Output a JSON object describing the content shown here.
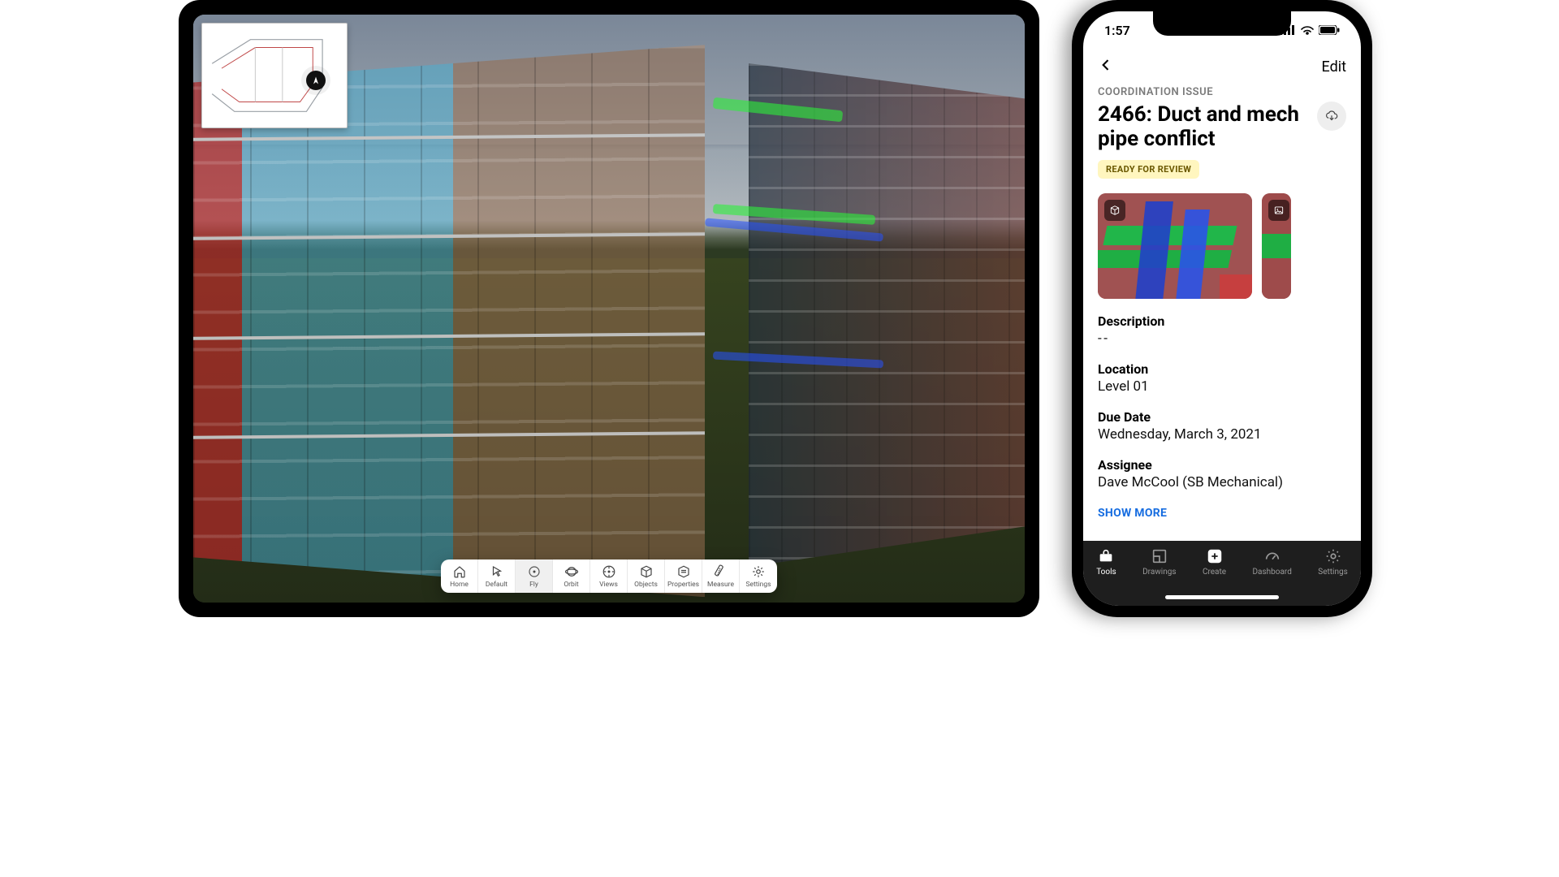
{
  "statusbar": {
    "time": "1:57"
  },
  "viewer": {
    "toolbar": [
      {
        "id": "home",
        "label": "Home"
      },
      {
        "id": "default",
        "label": "Default"
      },
      {
        "id": "fly",
        "label": "Fly",
        "active": true
      },
      {
        "id": "orbit",
        "label": "Orbit"
      },
      {
        "id": "views",
        "label": "Views"
      },
      {
        "id": "objects",
        "label": "Objects"
      },
      {
        "id": "properties",
        "label": "Properties"
      },
      {
        "id": "measure",
        "label": "Measure"
      },
      {
        "id": "settings",
        "label": "Settings"
      }
    ]
  },
  "issue": {
    "nav_edit": "Edit",
    "eyebrow": "COORDINATION ISSUE",
    "title": "2466: Duct and mech pipe conflict",
    "status_badge": "READY FOR REVIEW",
    "description_label": "Description",
    "description_value": "--",
    "location_label": "Location",
    "location_value": "Level 01",
    "due_label": "Due Date",
    "due_value": "Wednesday, March 3, 2021",
    "assignee_label": "Assignee",
    "assignee_value": "Dave McCool (SB Mechanical)",
    "show_more": "SHOW MORE"
  },
  "tabs": [
    {
      "id": "tools",
      "label": "Tools",
      "active": true
    },
    {
      "id": "drawings",
      "label": "Drawings"
    },
    {
      "id": "create",
      "label": "Create"
    },
    {
      "id": "dashboard",
      "label": "Dashboard"
    },
    {
      "id": "settings",
      "label": "Settings"
    }
  ]
}
